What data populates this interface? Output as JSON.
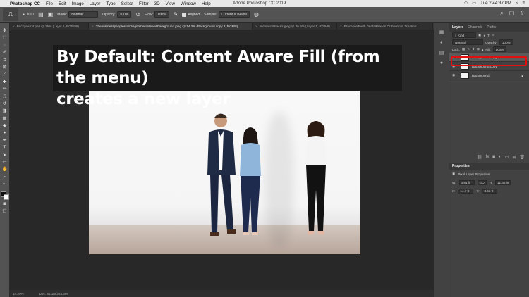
{
  "menubar": {
    "apple": "",
    "app_name": "Photoshop CC",
    "items": [
      "File",
      "Edit",
      "Image",
      "Layer",
      "Type",
      "Select",
      "Filter",
      "3D",
      "View",
      "Window",
      "Help"
    ],
    "window_title": "Adobe Photoshop CC 2019",
    "clock": "Tue 2:44:37 PM"
  },
  "options": {
    "brush_size": "1000",
    "mode_label": "Mode:",
    "mode_value": "Normal",
    "opacity_label": "Opacity:",
    "opacity_value": "100%",
    "flow_label": "Flow:",
    "flow_value": "100%",
    "aligned_label": "Aligned",
    "sample_label": "Sample:",
    "sample_value": "Current & Below"
  },
  "tabs": [
    {
      "label": "Background.psd @ 25% (Layer 1, RGB/8#)"
    },
    {
      "label": "Thebusinesspeoplestandingonthewhitewallbackground.jpeg @ 14.2% (Background copy 2, RGB/8)"
    },
    {
      "label": "WomanInBraces.jpeg @ 46.6% (Layer 1, RGB/8)"
    },
    {
      "label": "BracesonTeeth.DentalBraces.Orthodontic.Treatme..."
    }
  ],
  "overlay": {
    "line1": "By Default: Content Aware Fill (from the menu)",
    "line2": "creates a new layer"
  },
  "status": {
    "zoom": "14.29%",
    "doc": "Doc: 81.1M/283.3M"
  },
  "layers_panel": {
    "tabs": [
      "Layers",
      "Channels",
      "Paths"
    ],
    "kind": "Kind",
    "blend": "Normal",
    "opacity_label": "Opacity:",
    "opacity_value": "100%",
    "lock_label": "Lock:",
    "fill_label": "Fill:",
    "fill_value": "100%",
    "layers": [
      {
        "name": "Background copy 2"
      },
      {
        "name": "Background copy"
      },
      {
        "name": "Background"
      }
    ]
  },
  "properties": {
    "title": "Properties",
    "subtitle": "Pixel Layer Properties",
    "w_label": "W:",
    "w_value": "3.81 ft",
    "go_label": "GO",
    "h_label": "H:",
    "h_value": "11.35 in",
    "x_label": "X:",
    "x_value": "14.7 ft",
    "y_label": "Y:",
    "y_value": "3.43 ft"
  },
  "colors": {
    "menubar": "#e8e8e8",
    "panel": "#424242",
    "workspace": "#282828",
    "highlight": "#e01010"
  }
}
